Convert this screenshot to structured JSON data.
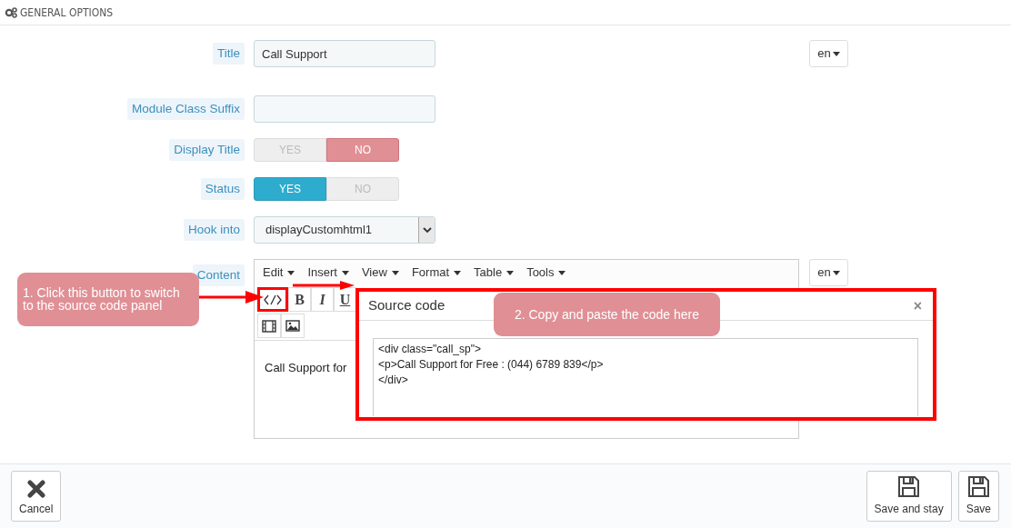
{
  "section": {
    "title": "GENERAL OPTIONS"
  },
  "fields": [
    {
      "kind": "text",
      "label": "Title",
      "value": "Call Support",
      "lang": "en"
    },
    {
      "kind": "text",
      "label": "Module Class Suffix"
    },
    {
      "kind": "switch",
      "label": "Display Title",
      "options": [
        {
          "kind": "yes",
          "label": "YES",
          "selected": false
        },
        {
          "kind": "no",
          "label": "NO",
          "selected": true
        }
      ]
    },
    {
      "kind": "switch",
      "label": "Status",
      "options": [
        {
          "kind": "yes",
          "label": "YES",
          "selected": true
        },
        {
          "kind": "no",
          "label": "NO",
          "selected": false
        }
      ]
    },
    {
      "kind": "select",
      "label": "Hook into",
      "value": "displayCustomhtml1"
    },
    {
      "kind": "editor",
      "label": "Content",
      "menus": [
        "Edit",
        "Insert",
        "View",
        "Format",
        "Table",
        "Tools"
      ],
      "tools": [
        "B",
        "I",
        "U"
      ],
      "body": "Call Support for",
      "lang": "en"
    }
  ],
  "dialog": {
    "title": "Source code",
    "close": "×",
    "code": "<div class=\"call_sp\">\n<p>Call Support for Free : (044) 6789 839</p>\n</div>"
  },
  "callouts": [
    "1. Click this button to switch to the source code panel",
    "2. Copy and paste the code here"
  ],
  "footer": {
    "buttons": [
      {
        "kind": "cancel",
        "label": "Cancel"
      },
      {
        "kind": "save",
        "label": "Save and stay"
      },
      {
        "kind": "save",
        "label": "Save"
      }
    ]
  }
}
